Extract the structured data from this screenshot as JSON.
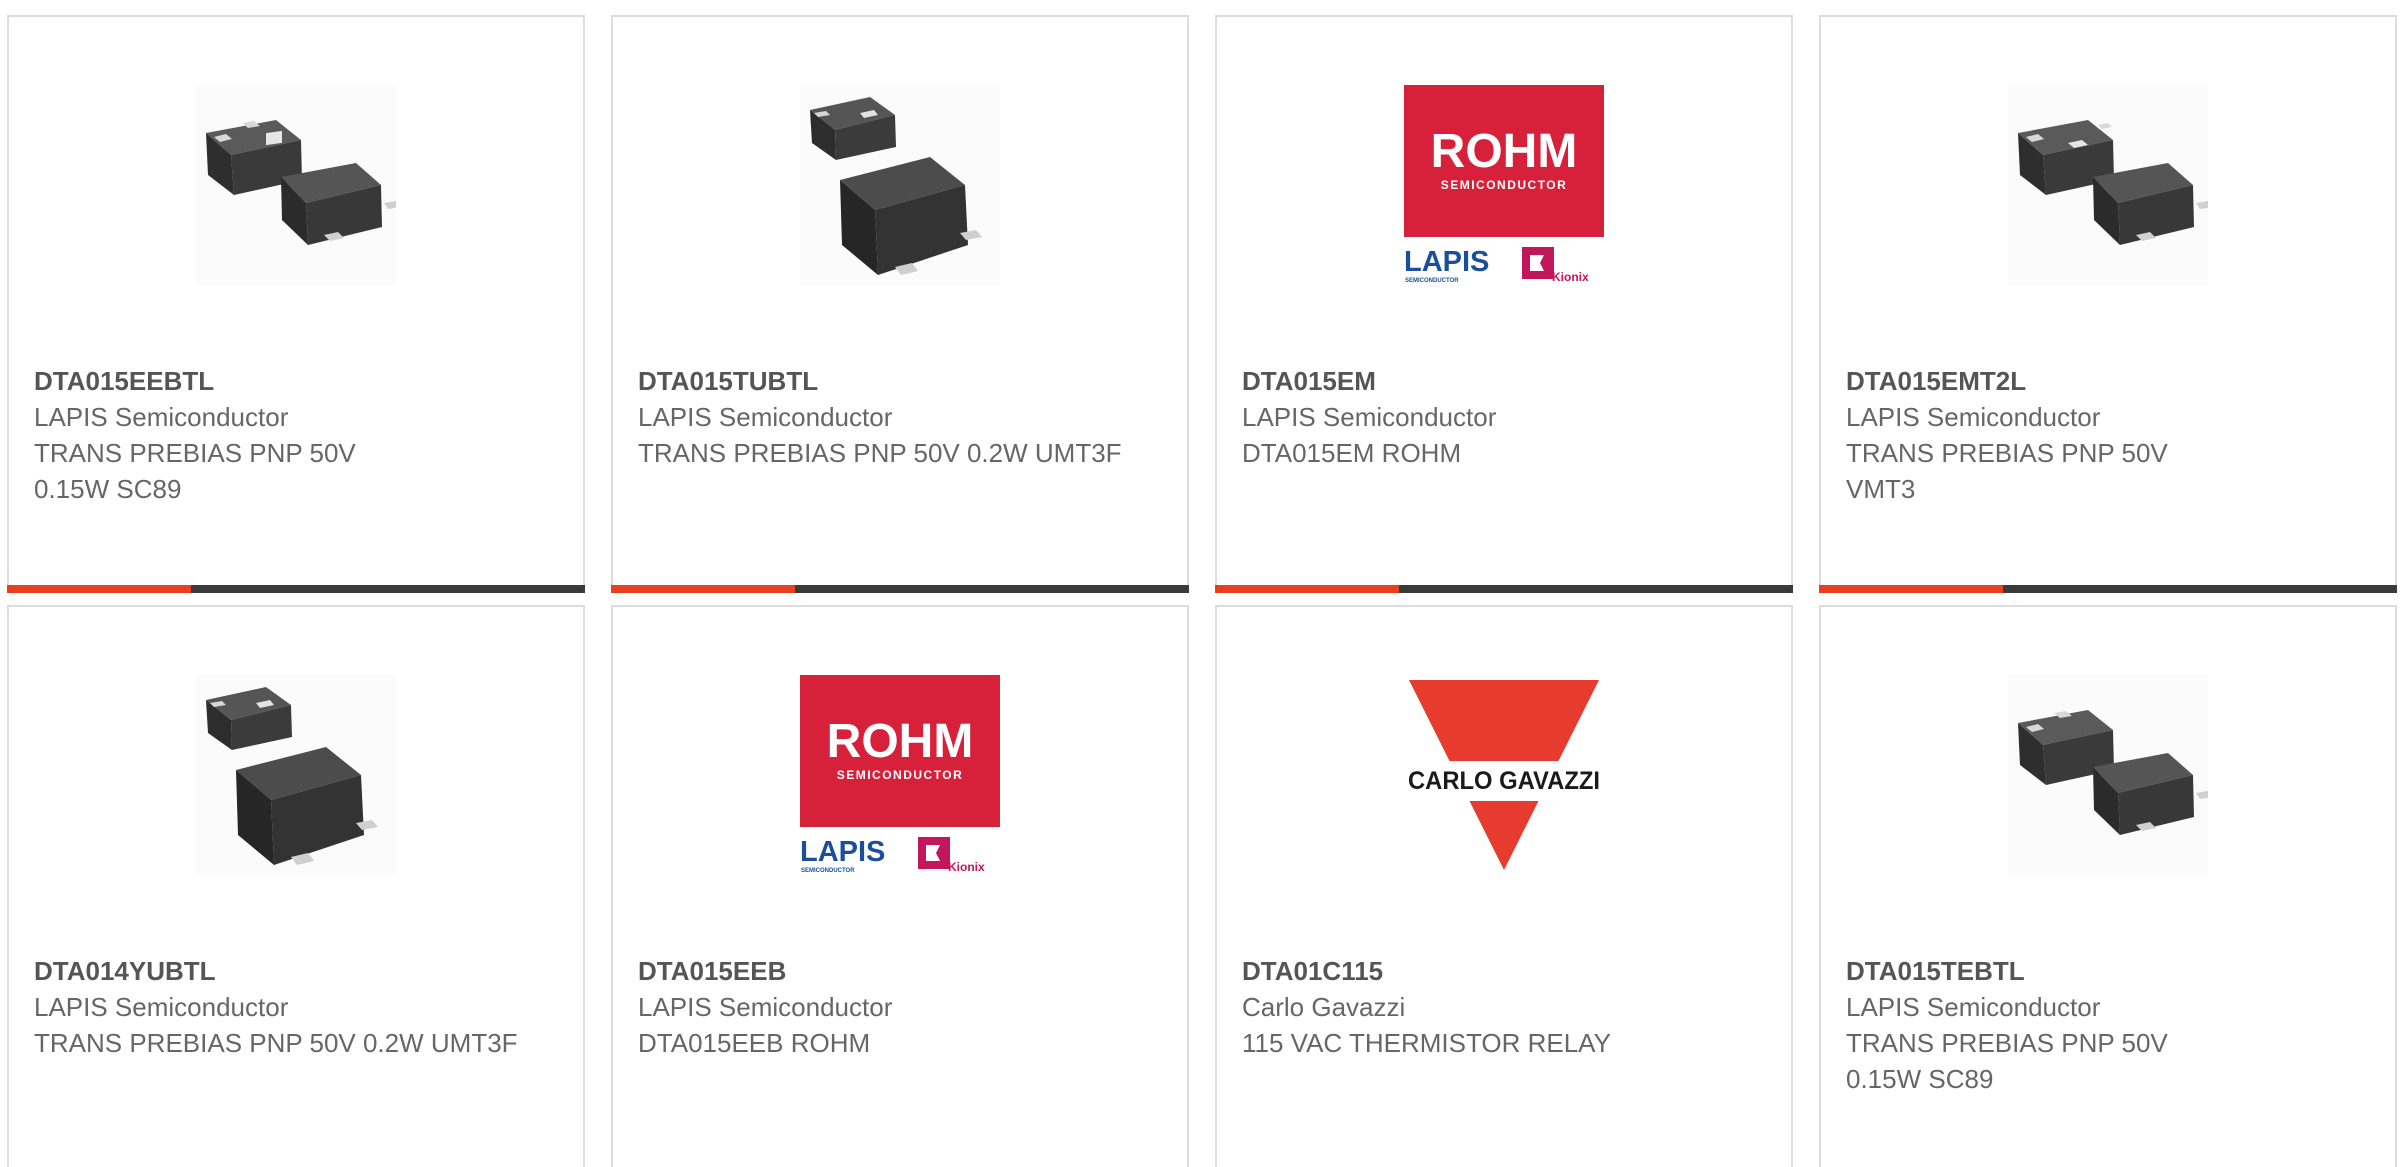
{
  "colors": {
    "accent": "#e8401c",
    "bar": "#3a3a3a",
    "border": "#dcdcdc",
    "rohm_red": "#d7203a",
    "lapis_blue": "#1b4f9c",
    "carlo_red": "#e63b2e"
  },
  "products": [
    {
      "part_number": "DTA015EEBTL",
      "manufacturer": "LAPIS Semiconductor",
      "description": "TRANS PREBIAS PNP 50V 0.15W SC89",
      "image": "transistor-twin-package-image"
    },
    {
      "part_number": "DTA015TUBTL",
      "manufacturer": "LAPIS Semiconductor",
      "description": "TRANS PREBIAS PNP 50V 0.2W UMT3F",
      "image": "transistor-package-image"
    },
    {
      "part_number": "DTA015EM",
      "manufacturer": "LAPIS Semiconductor",
      "description": "DTA015EM ROHM",
      "image": "rohm-logo",
      "logo": {
        "brand": "ROHM",
        "sub": "SEMICONDUCTOR",
        "lapis": "LAPIS",
        "lapis_sub": "SEMICONDUCTOR",
        "kionix": "Kionix"
      }
    },
    {
      "part_number": "DTA015EMT2L",
      "manufacturer": "LAPIS Semiconductor",
      "description": "TRANS PREBIAS PNP 50V VMT3",
      "image": "transistor-twin-package-image"
    },
    {
      "part_number": "DTA014YUBTL",
      "manufacturer": "LAPIS Semiconductor",
      "description": "TRANS PREBIAS PNP 50V 0.2W UMT3F",
      "image": "transistor-package-image"
    },
    {
      "part_number": "DTA015EEB",
      "manufacturer": "LAPIS Semiconductor",
      "description": "DTA015EEB ROHM",
      "image": "rohm-logo",
      "logo": {
        "brand": "ROHM",
        "sub": "SEMICONDUCTOR",
        "lapis": "LAPIS",
        "lapis_sub": "SEMICONDUCTOR",
        "kionix": "Kionix"
      }
    },
    {
      "part_number": "DTA01C115",
      "manufacturer": "Carlo Gavazzi",
      "description": "115 VAC THERMISTOR RELAY",
      "image": "carlo-gavazzi-logo",
      "logo": {
        "brand": "CARLO GAVAZZI"
      }
    },
    {
      "part_number": "DTA015TEBTL",
      "manufacturer": "LAPIS Semiconductor",
      "description": "TRANS PREBIAS PNP 50V 0.15W SC89",
      "image": "transistor-twin-package-image"
    }
  ]
}
